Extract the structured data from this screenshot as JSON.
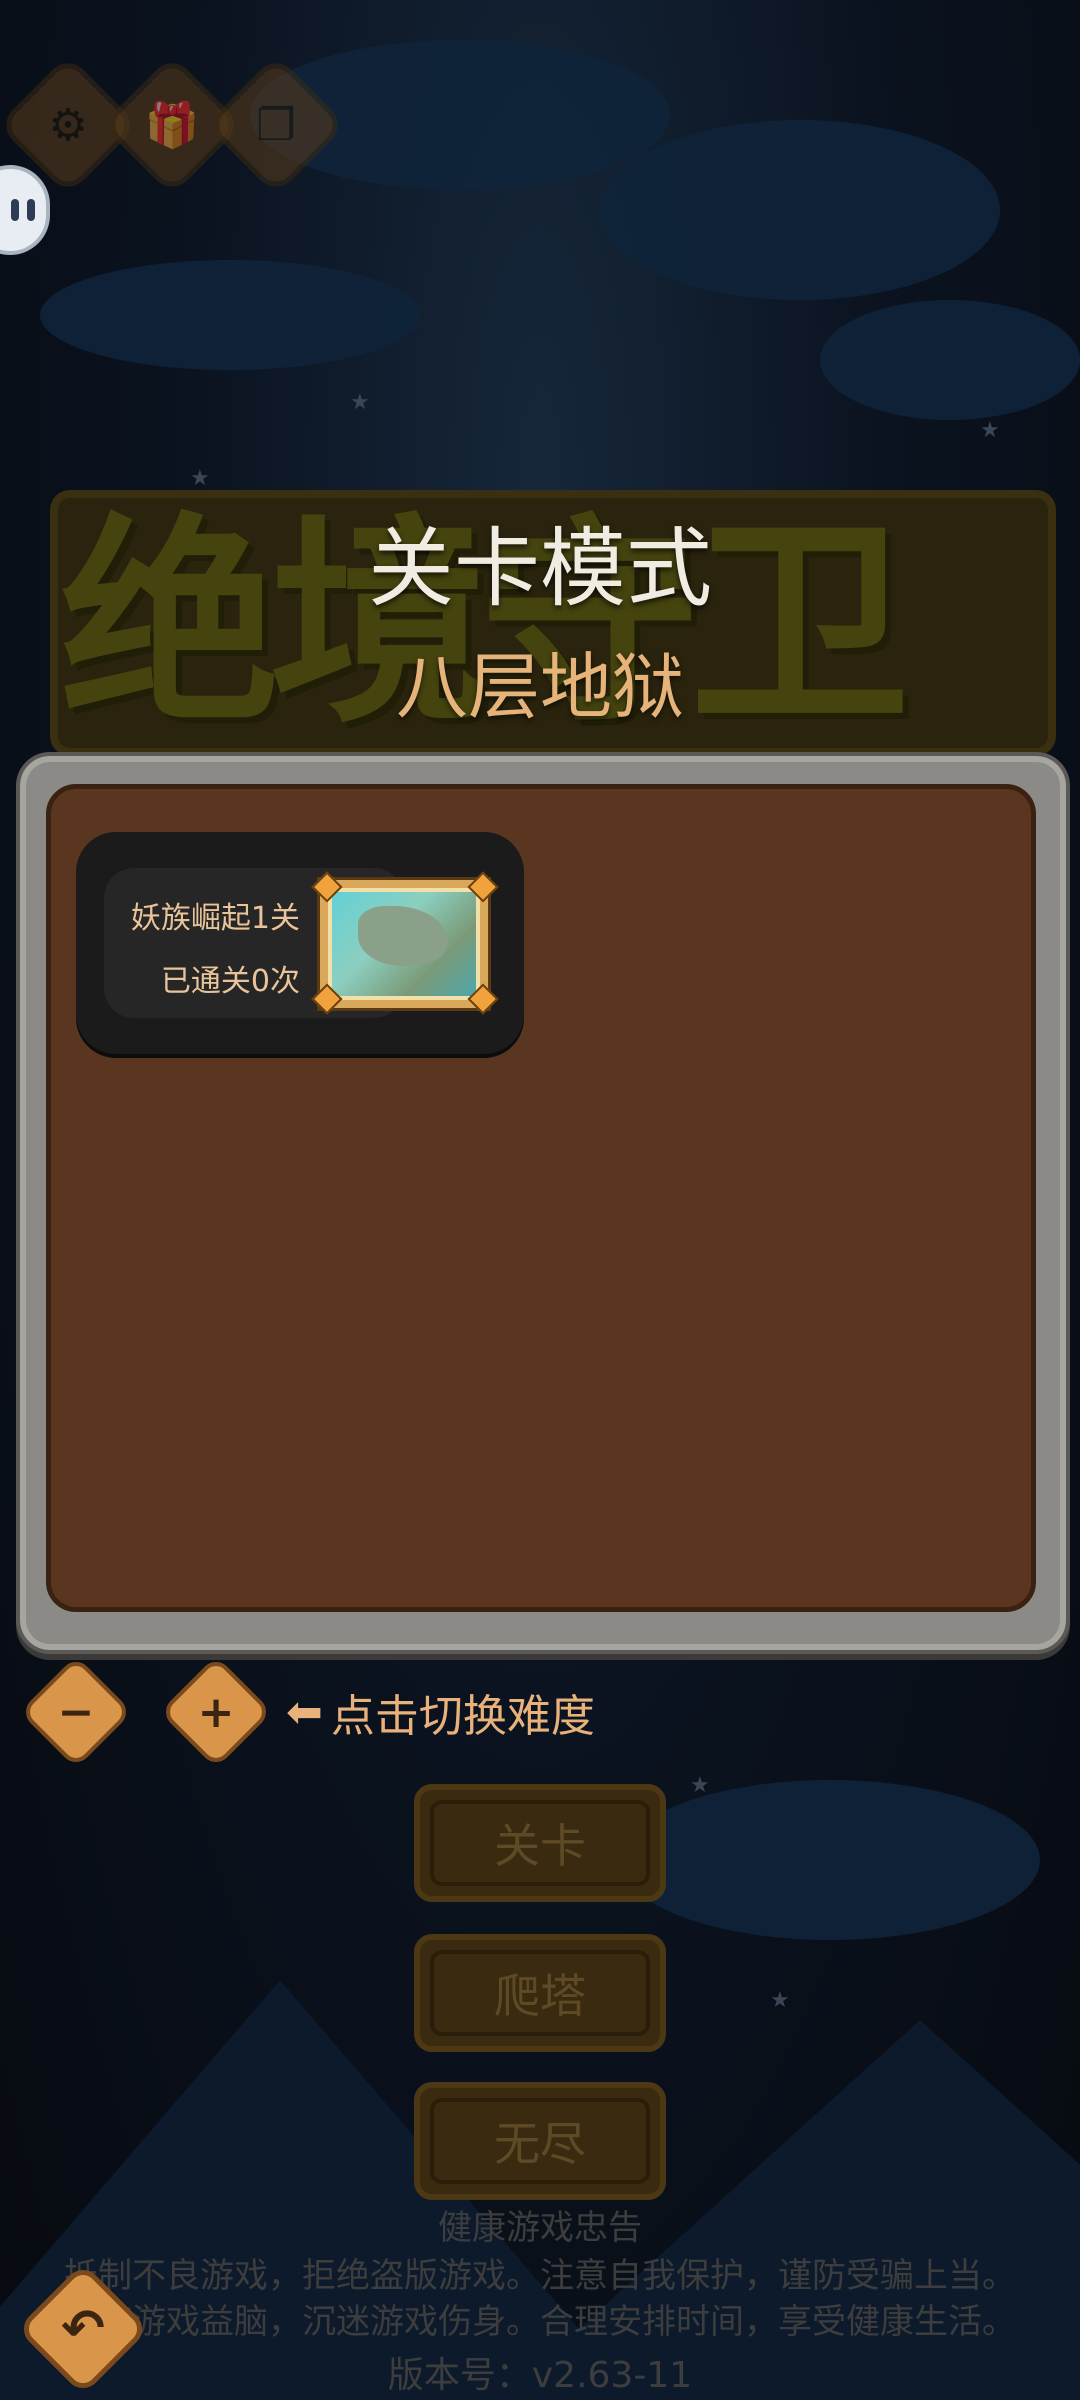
{
  "top_bar": {
    "settings_icon": "gear-icon",
    "gift_icon": "gift-icon",
    "copy_icon": "copy-icon"
  },
  "title": {
    "logo_text": "绝境守卫",
    "mode": "关卡模式",
    "difficulty": "八层地狱"
  },
  "levels": [
    {
      "name": "妖族崛起1关",
      "clears": "已通关0次"
    }
  ],
  "difficulty_controls": {
    "minus": "−",
    "plus": "+",
    "hint_arrow": "⬅",
    "hint": "点击切换难度"
  },
  "mode_buttons": {
    "stage": "关卡",
    "tower": "爬塔",
    "endless": "无尽"
  },
  "footer": {
    "advice_title": "健康游戏忠告",
    "advice_line_1": "抵制不良游戏，拒绝盗版游戏。注意自我保护，谨防受骗上当。",
    "advice_line_2": "适度游戏益脑，沉迷游戏伤身。合理安排时间，享受健康生活。",
    "version": "版本号：v2.63-11"
  },
  "colors": {
    "accent": "#d9954a",
    "panel": "#5a3620",
    "title_text": "#f1ece2",
    "difficulty_text": "#e6b47a"
  }
}
